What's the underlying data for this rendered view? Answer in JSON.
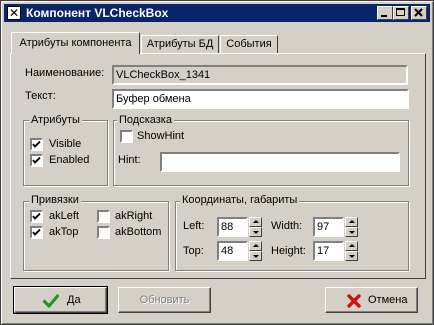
{
  "window": {
    "title": "Компонент VLCheckBox",
    "icon_glyph": "✕"
  },
  "tabs": [
    {
      "label": "Атрибуты компонента",
      "active": true
    },
    {
      "label": "Атрибуты БД",
      "active": false
    },
    {
      "label": "События",
      "active": false
    }
  ],
  "form": {
    "name_label": "Наименование:",
    "name_value": "VLCheckBox_1341",
    "text_label": "Текст:",
    "text_value": "Буфер обмена"
  },
  "attributes": {
    "title": "Атрибуты",
    "visible_label": "Visible",
    "visible_checked": true,
    "enabled_label": "Enabled",
    "enabled_checked": true
  },
  "hint": {
    "title": "Подсказка",
    "showhint_label": "ShowHint",
    "showhint_checked": false,
    "hint_label": "Hint:",
    "hint_value": ""
  },
  "anchors": {
    "title": "Привязки",
    "left_label": "akLeft",
    "left_checked": true,
    "right_label": "akRight",
    "right_checked": false,
    "top_label": "akTop",
    "top_checked": true,
    "bottom_label": "akBottom",
    "bottom_checked": false
  },
  "coords": {
    "title": "Координаты, габариты",
    "left_label": "Left:",
    "left_value": "88",
    "top_label": "Top:",
    "top_value": "48",
    "width_label": "Width:",
    "width_value": "97",
    "height_label": "Height:",
    "height_value": "17"
  },
  "buttons": {
    "ok_label": "Да",
    "refresh_label": "Обновить",
    "cancel_label": "Отмена"
  },
  "colors": {
    "titlebar": "#0a246a",
    "face": "#d4d0c8",
    "ok_icon": "#1a9a1a",
    "cancel_icon": "#cc1010"
  }
}
